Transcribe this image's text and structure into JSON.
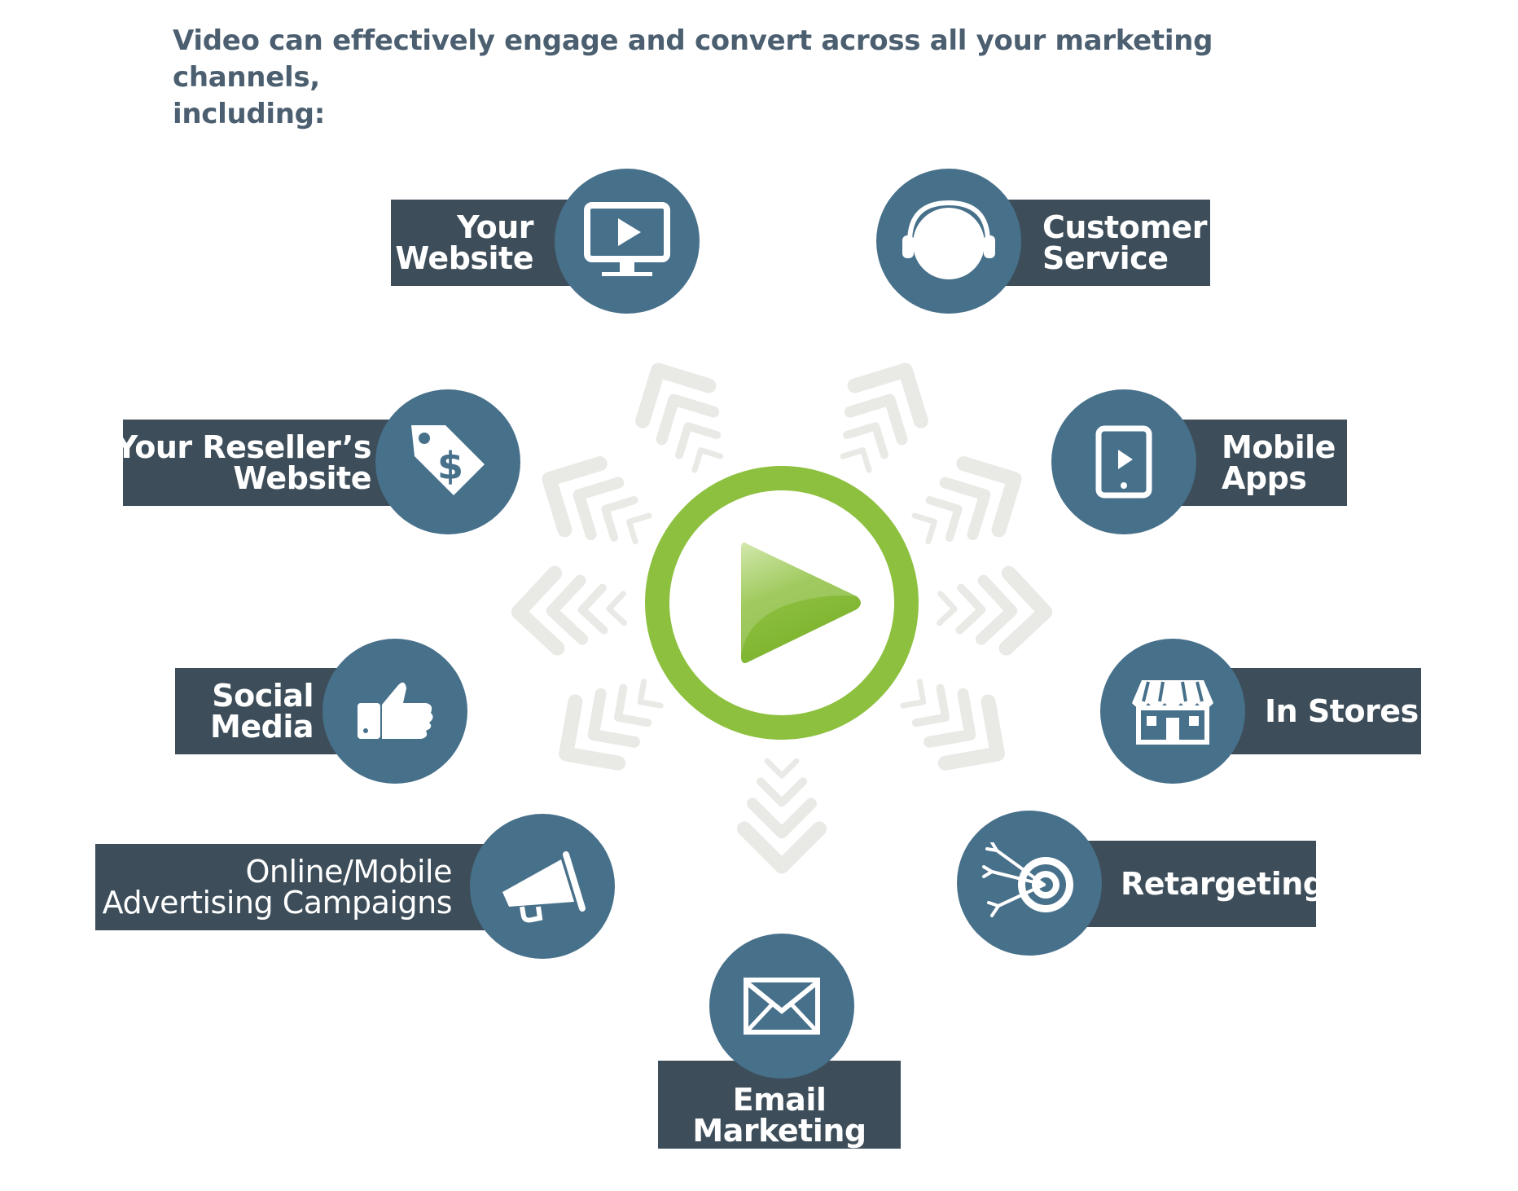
{
  "headline": {
    "line1": "Video can effectively engage and convert across all your marketing channels,",
    "line2": "including:"
  },
  "colors": {
    "headline": "#4b5f70",
    "label_bg": "#3d4e5a",
    "circle": "#47708a",
    "play_ring": "#8dc03f",
    "arrows": "#e9e9e6"
  },
  "channels": {
    "your_website": {
      "line1": "Your",
      "line2": "Website",
      "icon": "monitor-play-icon"
    },
    "customer_service": {
      "line1": "Customer",
      "line2": "Service",
      "icon": "headset-icon"
    },
    "resellers_website": {
      "line1": "Your Reseller’s",
      "line2": "Website",
      "icon": "price-tag-dollar-icon"
    },
    "mobile_apps": {
      "line1": "Mobile",
      "line2": "Apps",
      "icon": "tablet-play-icon"
    },
    "social_media": {
      "line1": "Social",
      "line2": "Media",
      "icon": "thumbs-up-icon"
    },
    "in_stores": {
      "line1": "In Stores",
      "icon": "storefront-icon"
    },
    "online_ads": {
      "line1": "Online/Mobile",
      "line2": "Advertising Campaigns",
      "icon": "megaphone-icon"
    },
    "retargeting": {
      "line1": "Retargeting",
      "icon": "target-arrows-icon"
    },
    "email_marketing": {
      "line1": "Email",
      "line2": "Marketing",
      "icon": "envelope-icon"
    }
  },
  "center_icon": "play-button-icon"
}
